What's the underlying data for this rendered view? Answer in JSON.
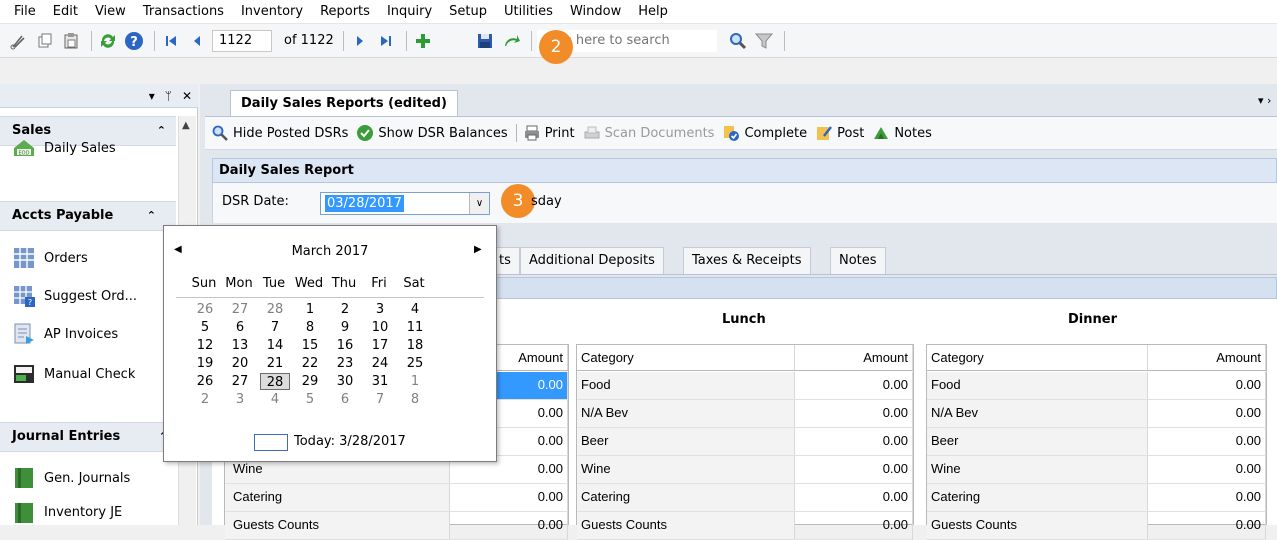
{
  "menu": [
    "File",
    "Edit",
    "View",
    "Transactions",
    "Inventory",
    "Reports",
    "Inquiry",
    "Setup",
    "Utilities",
    "Window",
    "Help"
  ],
  "toolbar": {
    "record_current": "1122",
    "record_of": "of 1122",
    "search_placeholder": "type here to search",
    "step_badge": "2",
    "icons": [
      "scissors-icon",
      "copy-icon",
      "paste-icon",
      "refresh-icon",
      "help-icon",
      "first-record-icon",
      "prev-record-icon",
      "next-record-icon",
      "last-record-icon",
      "add-icon",
      "save-icon",
      "undo-icon",
      "search-icon",
      "filter-icon"
    ]
  },
  "panel": {
    "groups": [
      {
        "label": "Sales",
        "items": [
          "Daily Sales"
        ]
      },
      {
        "label": "Accts Payable",
        "items": [
          "Orders",
          "Suggest Ord...",
          "AP Invoices",
          "Manual Check"
        ]
      },
      {
        "label": "Journal Entries",
        "items": [
          "Gen. Journals",
          "Inventory JE"
        ]
      }
    ]
  },
  "document": {
    "tab_title": "Daily Sales Reports (edited)",
    "actions": [
      "Hide Posted DSRs",
      "Show DSR Balances",
      "Print",
      "Scan Documents",
      "Complete",
      "Post",
      "Notes"
    ],
    "section_title": "Daily Sales Report",
    "dsr_date_label": "DSR Date:",
    "dsr_date_value": "03/28/2017",
    "day_label_visible": "sday",
    "step_badge": "3",
    "tabs": [
      "ts",
      "Additional Deposits",
      "Taxes & Receipts",
      "Notes"
    ]
  },
  "grid": {
    "meals": [
      {
        "title": "",
        "columns": [
          "Category",
          "Amount"
        ]
      },
      {
        "title": "Lunch",
        "columns": [
          "Category",
          "Amount"
        ]
      },
      {
        "title": "Dinner",
        "columns": [
          "Category",
          "Amount"
        ]
      }
    ],
    "categories": [
      "Food",
      "N/A Bev",
      "Beer",
      "Wine",
      "Catering",
      "Guests Counts"
    ],
    "amount": "0.00"
  },
  "calendar": {
    "title": "March 2017",
    "weekdays": [
      "Sun",
      "Mon",
      "Tue",
      "Wed",
      "Thu",
      "Fri",
      "Sat"
    ],
    "weeks": [
      [
        [
          "26",
          1
        ],
        [
          "27",
          1
        ],
        [
          "28",
          1
        ],
        [
          "1",
          0
        ],
        [
          "2",
          0
        ],
        [
          "3",
          0
        ],
        [
          "4",
          0
        ]
      ],
      [
        [
          "5",
          0
        ],
        [
          "6",
          0
        ],
        [
          "7",
          0
        ],
        [
          "8",
          0
        ],
        [
          "9",
          0
        ],
        [
          "10",
          0
        ],
        [
          "11",
          0
        ]
      ],
      [
        [
          "12",
          0
        ],
        [
          "13",
          0
        ],
        [
          "14",
          0
        ],
        [
          "15",
          0
        ],
        [
          "16",
          0
        ],
        [
          "17",
          0
        ],
        [
          "18",
          0
        ]
      ],
      [
        [
          "19",
          0
        ],
        [
          "20",
          0
        ],
        [
          "21",
          0
        ],
        [
          "22",
          0
        ],
        [
          "23",
          0
        ],
        [
          "24",
          0
        ],
        [
          "25",
          0
        ]
      ],
      [
        [
          "26",
          0
        ],
        [
          "27",
          0
        ],
        [
          "28",
          2
        ],
        [
          "29",
          0
        ],
        [
          "30",
          0
        ],
        [
          "31",
          0
        ],
        [
          "1",
          1
        ]
      ],
      [
        [
          "2",
          1
        ],
        [
          "3",
          1
        ],
        [
          "4",
          1
        ],
        [
          "5",
          1
        ],
        [
          "6",
          1
        ],
        [
          "7",
          1
        ],
        [
          "8",
          1
        ]
      ]
    ],
    "today_text": "Today: 3/28/2017"
  },
  "colors": {
    "accent_badge": "#f28c28",
    "selection": "#3399ff",
    "header_band": "#dde6f4"
  }
}
